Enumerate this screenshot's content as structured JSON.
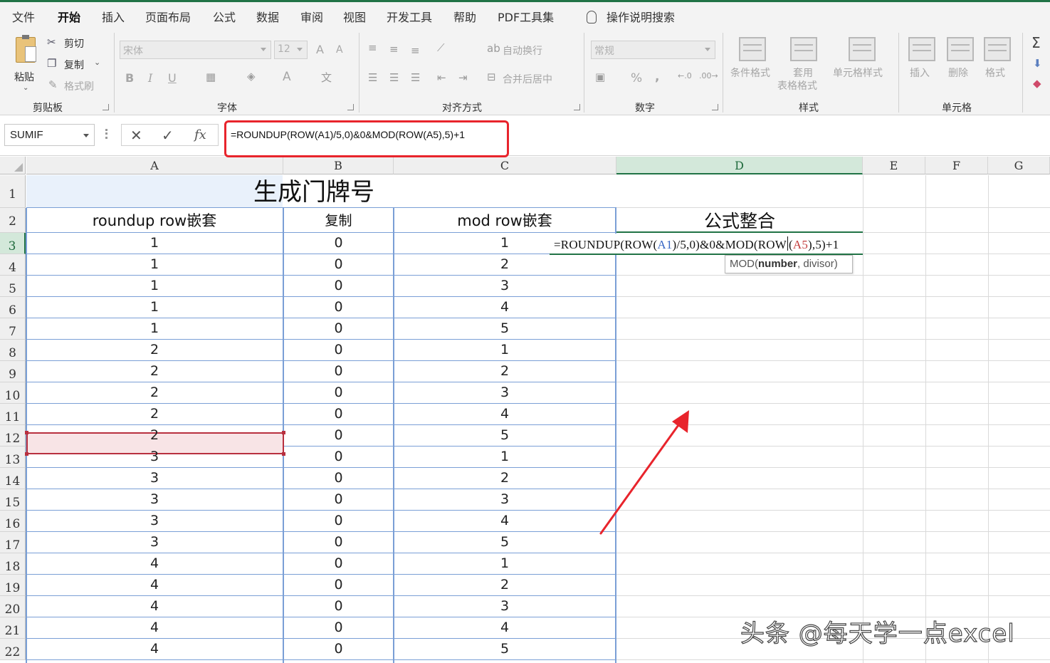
{
  "menu": {
    "tabs": [
      "文件",
      "开始",
      "插入",
      "页面布局",
      "公式",
      "数据",
      "审阅",
      "视图",
      "开发工具",
      "帮助",
      "PDF工具集"
    ],
    "active_tab": "开始",
    "tell_me": "操作说明搜索"
  },
  "ribbon": {
    "clipboard": {
      "label": "剪贴板",
      "paste": "粘贴",
      "cut": "剪切",
      "copy": "复制",
      "format_painter": "格式刷"
    },
    "font": {
      "label": "字体",
      "font_name": "宋体",
      "font_size": "12",
      "bold": "B",
      "italic": "I",
      "underline": "U",
      "grow": "A",
      "shrink": "A",
      "font_color": "A"
    },
    "alignment": {
      "label": "对齐方式",
      "wrap_text": "自动换行",
      "merge_center": "合并后居中"
    },
    "number": {
      "label": "数字",
      "format": "常规",
      "percent": "%",
      "comma": ","
    },
    "styles": {
      "label": "样式",
      "conditional": "条件格式",
      "table_format_1": "套用",
      "table_format_2": "表格格式",
      "cell_styles": "单元格样式"
    },
    "cells": {
      "label": "单元格",
      "insert": "插入",
      "delete": "删除",
      "format": "格式"
    },
    "editing": {
      "sum": "Σ"
    }
  },
  "formula_bar": {
    "name_box": "SUMIF",
    "cancel": "✕",
    "enter": "✓",
    "fx": "fx",
    "formula": "=ROUNDUP(ROW(A1)/5,0)&0&MOD(ROW(A5),5)+1"
  },
  "columns": [
    "A",
    "B",
    "C",
    "D",
    "E",
    "F",
    "G"
  ],
  "selected_column": "D",
  "rows": [
    "1",
    "2",
    "3",
    "4",
    "5",
    "6",
    "7",
    "8",
    "9",
    "10",
    "11",
    "12",
    "13",
    "14",
    "15",
    "16",
    "17",
    "18",
    "19",
    "20",
    "21",
    "22"
  ],
  "selected_row": "3",
  "sheet": {
    "title": "生成门牌号",
    "headers": {
      "a": "roundup row嵌套",
      "b": "复制",
      "c": "mod row嵌套",
      "d": "公式整合"
    },
    "data": [
      [
        "1",
        "0",
        "1"
      ],
      [
        "1",
        "0",
        "2"
      ],
      [
        "1",
        "0",
        "3"
      ],
      [
        "1",
        "0",
        "4"
      ],
      [
        "1",
        "0",
        "5"
      ],
      [
        "2",
        "0",
        "1"
      ],
      [
        "2",
        "0",
        "2"
      ],
      [
        "2",
        "0",
        "3"
      ],
      [
        "2",
        "0",
        "4"
      ],
      [
        "2",
        "0",
        "5"
      ],
      [
        "3",
        "0",
        "1"
      ],
      [
        "3",
        "0",
        "2"
      ],
      [
        "3",
        "0",
        "3"
      ],
      [
        "3",
        "0",
        "4"
      ],
      [
        "3",
        "0",
        "5"
      ],
      [
        "4",
        "0",
        "1"
      ],
      [
        "4",
        "0",
        "2"
      ],
      [
        "4",
        "0",
        "3"
      ],
      [
        "4",
        "0",
        "4"
      ],
      [
        "4",
        "0",
        "5"
      ]
    ],
    "editing_cell": {
      "part1": "=ROUNDUP(ROW(",
      "ref1": "A1",
      "part2": ")/5,0)&0&MOD(ROW",
      "part3": "(",
      "ref2": "A5",
      "part4": "),5)+1"
    },
    "tooltip": {
      "func": "MOD(",
      "arg1": "number",
      "rest": ", divisor)"
    }
  },
  "colors": {
    "accent": "#217346",
    "table_border": "#7a9fd6",
    "highlight_red": "#e8242c"
  },
  "watermark": "头条 @每天学一点excel"
}
